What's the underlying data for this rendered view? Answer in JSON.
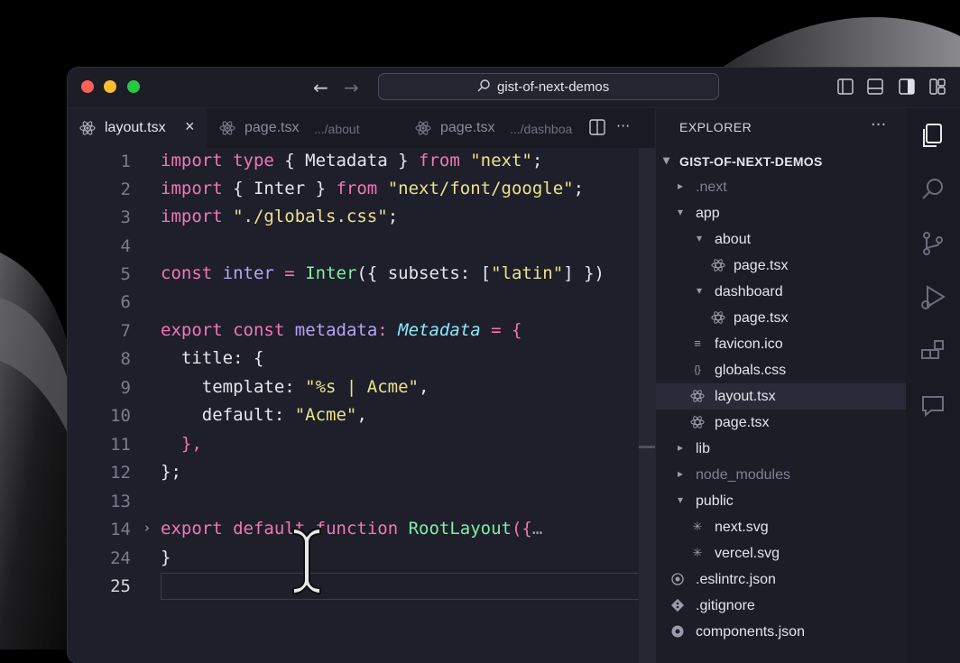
{
  "titlebar": {
    "search_text": "gist-of-next-demos",
    "back_arrow": "←",
    "forward_arrow": "→"
  },
  "tabs": [
    {
      "name": "layout.tsx",
      "path": "",
      "close": "×",
      "active": true
    },
    {
      "name": "page.tsx",
      "path": ".../about",
      "active": false
    },
    {
      "name": "page.tsx",
      "path": ".../dashboa",
      "active": false
    }
  ],
  "tabbar_more": "···",
  "editor": {
    "lines": [
      {
        "num": "1"
      },
      {
        "num": "2"
      },
      {
        "num": "3"
      },
      {
        "num": "4"
      },
      {
        "num": "5"
      },
      {
        "num": "6"
      },
      {
        "num": "7"
      },
      {
        "num": "8"
      },
      {
        "num": "9"
      },
      {
        "num": "10"
      },
      {
        "num": "11"
      },
      {
        "num": "12"
      },
      {
        "num": "13"
      },
      {
        "num": "14"
      },
      {
        "num": "24"
      },
      {
        "num": "25"
      }
    ],
    "code": {
      "l1": [
        "import",
        " type",
        " { Metadata } ",
        "from",
        " ",
        "\"next\"",
        ";"
      ],
      "l2": [
        "import",
        " { Inter } ",
        "from",
        " ",
        "\"next/font/google\"",
        ";"
      ],
      "l3": [
        "import",
        " ",
        "\"./globals.css\"",
        ";"
      ],
      "l5": [
        "const",
        " ",
        "inter",
        " = ",
        "Inter",
        "({ subsets: [",
        "\"latin\"",
        "] })"
      ],
      "l7": [
        "export",
        " ",
        "const",
        " ",
        "metadata",
        ": ",
        "Metadata",
        " = {"
      ],
      "l8": [
        "  title: {"
      ],
      "l9": [
        "    template: ",
        "\"%s | Acme\"",
        ","
      ],
      "l10": [
        "    default: ",
        "\"Acme\"",
        ","
      ],
      "l11": [
        "  },"
      ],
      "l12": [
        "};"
      ],
      "l14": [
        "export",
        " ",
        "default",
        " ",
        "function",
        " ",
        "RootLayout",
        "({",
        "…"
      ],
      "l24": [
        "}"
      ]
    }
  },
  "explorer": {
    "title": "EXPLORER",
    "more": "···",
    "root": "GIST-OF-NEXT-DEMOS",
    "items": [
      {
        "label": ".next",
        "kind": "folder-collapsed",
        "dim": true
      },
      {
        "label": "app",
        "kind": "folder-open"
      },
      {
        "label": "about",
        "kind": "folder-open"
      },
      {
        "label": "page.tsx",
        "kind": "react"
      },
      {
        "label": "dashboard",
        "kind": "folder-open"
      },
      {
        "label": "page.tsx",
        "kind": "react"
      },
      {
        "label": "favicon.ico",
        "kind": "file"
      },
      {
        "label": "globals.css",
        "kind": "css"
      },
      {
        "label": "layout.tsx",
        "kind": "react",
        "selected": true
      },
      {
        "label": "page.tsx",
        "kind": "react"
      },
      {
        "label": "lib",
        "kind": "folder-collapsed"
      },
      {
        "label": "node_modules",
        "kind": "folder-collapsed",
        "dim": true
      },
      {
        "label": "public",
        "kind": "folder-open"
      },
      {
        "label": "next.svg",
        "kind": "svg"
      },
      {
        "label": "vercel.svg",
        "kind": "svg"
      },
      {
        "label": ".eslintrc.json",
        "kind": "eslint"
      },
      {
        "label": ".gitignore",
        "kind": "git"
      },
      {
        "label": "components.json",
        "kind": "json"
      }
    ]
  },
  "icons": {
    "tree_collapsed": "▸",
    "tree_expanded": "▾",
    "file_lines": "≡",
    "css_braces": "{}",
    "svg_star": "✳",
    "fold_chevron": "›"
  },
  "colors": {
    "keyword": "#f177b4",
    "string": "#ebe38a",
    "function": "#7ff0a4",
    "variable": "#b9a4f5",
    "type": "#8be9fd",
    "editor_bg": "#1e1f2b"
  }
}
